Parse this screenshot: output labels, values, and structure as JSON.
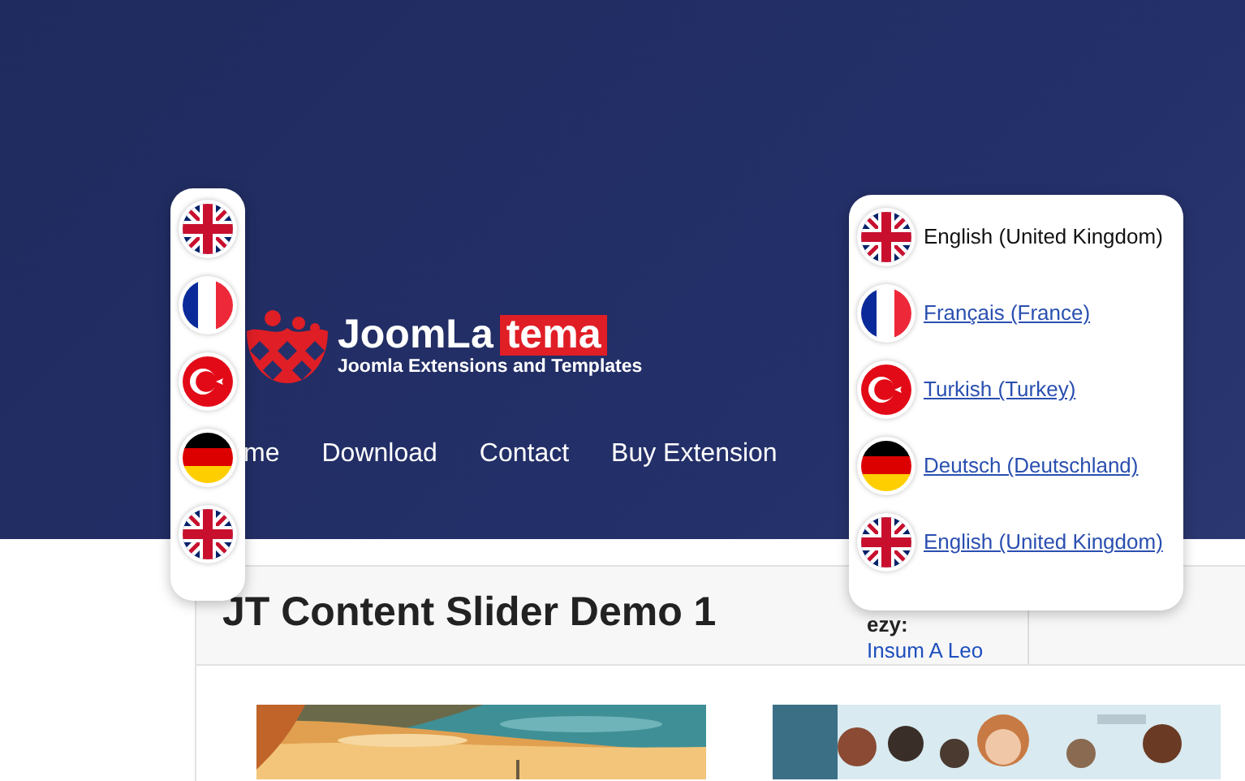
{
  "header": {
    "logo": {
      "word_1": "JoomLa",
      "word_2": "tema",
      "tagline": "Joomla Extensions and Templates"
    },
    "nav": [
      {
        "label": "me"
      },
      {
        "label": "Download"
      },
      {
        "label": "Contact"
      },
      {
        "label": "Buy Extension"
      }
    ]
  },
  "content": {
    "title": "JT Content Slider Demo 1",
    "side_heading": "ezy:",
    "side_link": "Insum A Leo"
  },
  "flag_bar": [
    {
      "kind": "uk"
    },
    {
      "kind": "france"
    },
    {
      "kind": "turkey"
    },
    {
      "kind": "germany"
    },
    {
      "kind": "uk"
    }
  ],
  "language_menu": [
    {
      "kind": "uk",
      "label": "English (United Kingdom)",
      "selected": true
    },
    {
      "kind": "france",
      "label": "Français (France)",
      "selected": false
    },
    {
      "kind": "turkey",
      "label": "Turkish (Turkey)",
      "selected": false
    },
    {
      "kind": "germany",
      "label": "Deutsch (Deutschland)",
      "selected": false
    },
    {
      "kind": "uk",
      "label": "English (United Kingdom)",
      "selected": false
    }
  ]
}
